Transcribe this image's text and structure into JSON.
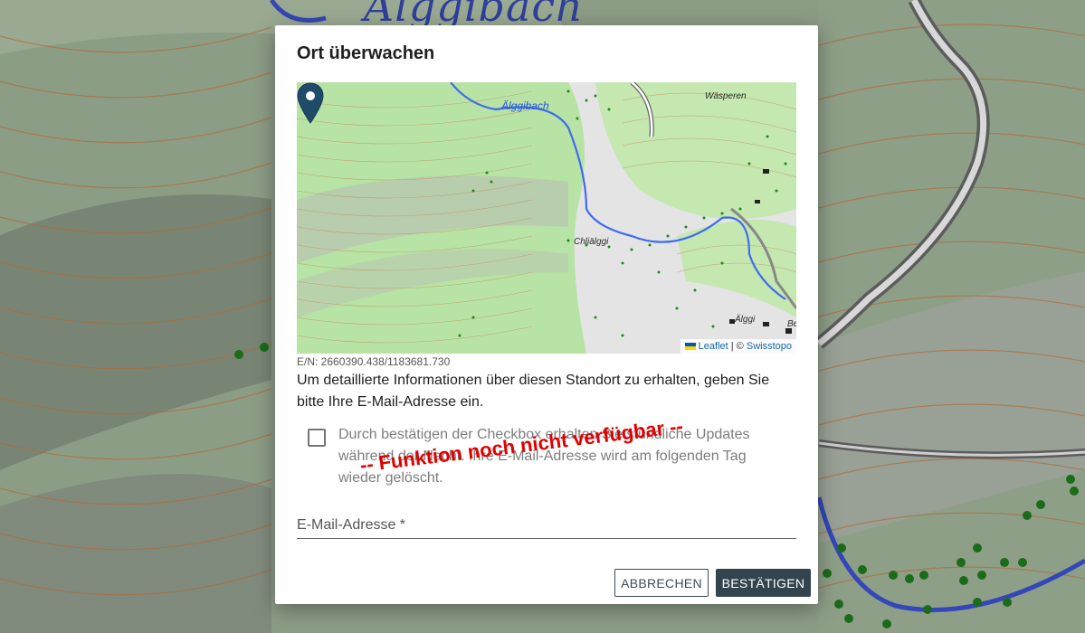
{
  "background": {
    "place_label": "Älggibach"
  },
  "dialog": {
    "title": "Ort überwachen",
    "map": {
      "labels": {
        "river": "Älggibach",
        "north": "Wäsperen",
        "village": "Chliälggi",
        "south": "Älggi",
        "edge": "Be"
      },
      "attribution": {
        "leaflet": "Leaflet",
        "separator": "| ©",
        "provider": "Swisstopo"
      }
    },
    "coordinates": "E/N: 2660390.438/1183681.730",
    "info_text": "Um detaillierte Informationen über diesen Standort zu erhalten, geben Sie bitte Ihre E-Mail-Adresse ein.",
    "checkbox": {
      "label": "Durch bestätigen der Checkbox erhalten Sie stündliche Updates während der Nacht. Ihre E-Mail-Adresse wird am folgenden Tag wieder gelöscht.",
      "checked": false
    },
    "overlay_notice": "-- Funktion noch nicht verfügbar --",
    "email": {
      "label": "E-Mail-Adresse *",
      "value": ""
    },
    "buttons": {
      "cancel": "ABBRECHEN",
      "confirm": "BESTÄTIGEN"
    }
  },
  "colors": {
    "primary_button": "#34444f",
    "notice_red": "#e00000",
    "link_blue": "#1569a8"
  }
}
